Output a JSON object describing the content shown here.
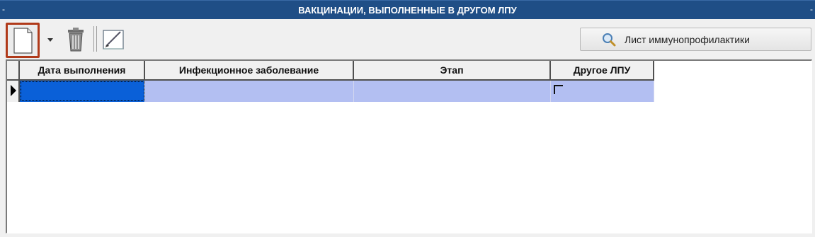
{
  "window": {
    "title": "ВАКЦИНАЦИИ, ВЫПОЛНЕННЫЕ В ДРУГОМ ЛПУ",
    "left_marker": "-",
    "right_marker": "-"
  },
  "toolbar": {
    "new_icon": "new-document-icon",
    "dropdown_icon": "chevron-down-icon",
    "delete_icon": "trash-icon",
    "edit_icon": "edit-icon",
    "report_button_label": "Лист иммунопрофилактики",
    "report_button_icon": "magnifier-icon",
    "highlight_color": "#b03a1a"
  },
  "grid": {
    "columns": [
      "Дата выполнения",
      "Инфекционное заболевание",
      "Этап",
      "Другое ЛПУ"
    ],
    "rows": [
      {
        "date": "",
        "disease": "",
        "stage": "",
        "other_lpu": false
      }
    ],
    "row_color": "#b3bff2",
    "selected_cell_color": "#0a60d8"
  }
}
